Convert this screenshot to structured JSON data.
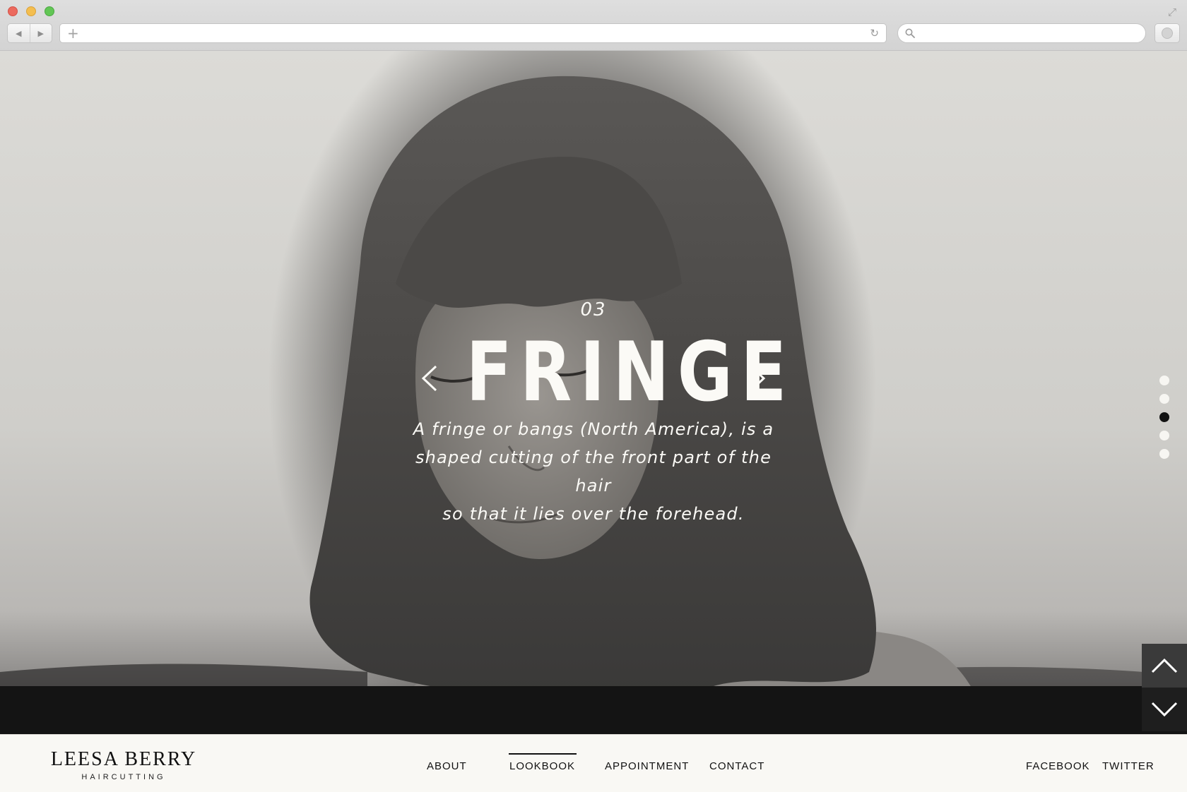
{
  "browser": {
    "url_placeholder": "",
    "search_placeholder": ""
  },
  "slide": {
    "number": "03",
    "title": "FRINGE",
    "description_lines": [
      "A fringe or bangs (North America), is a",
      "shaped cutting of the front part of the hair",
      "so that it lies over the forehead."
    ],
    "total_slides": 5,
    "active_index": 2
  },
  "brand": {
    "name": "LEESA BERRY",
    "tagline": "HAIRCUTTING"
  },
  "nav": {
    "items": [
      {
        "label": "ABOUT",
        "active": false
      },
      {
        "label": "LOOKBOOK",
        "active": true
      },
      {
        "label": "APPOINTMENT",
        "active": false
      },
      {
        "label": "CONTACT",
        "active": false
      }
    ]
  },
  "social": {
    "facebook": "FACEBOOK",
    "twitter": "TWITTER"
  },
  "colors": {
    "caption_text": "#fbfaf6",
    "footer_bg": "#f9f8f4",
    "dark_band": "#141414",
    "pager_active": "#121212"
  },
  "icons": {
    "prev": "chevron-left-icon",
    "next": "chevron-right-icon",
    "up": "chevron-up-icon",
    "down": "chevron-down-icon",
    "search": "search-icon",
    "reload": "reload-icon"
  }
}
